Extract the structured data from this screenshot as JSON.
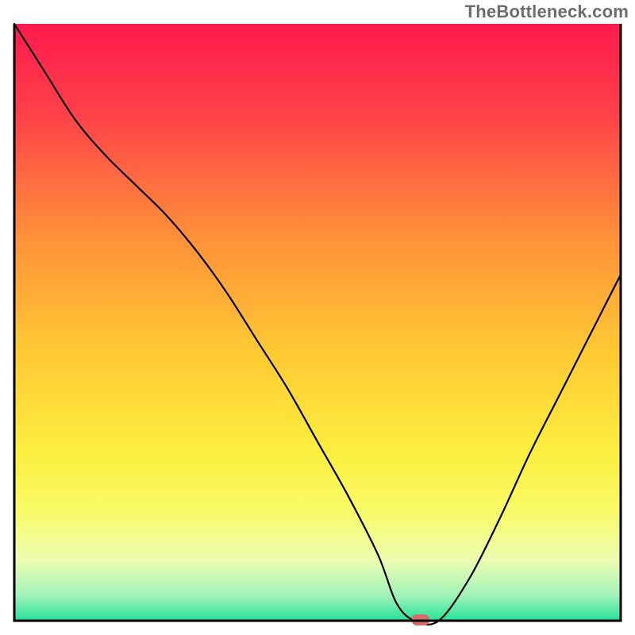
{
  "watermark": "TheBottleneck.com",
  "chart_data": {
    "type": "line",
    "title": "",
    "xlabel": "",
    "ylabel": "",
    "xlim": [
      0,
      100
    ],
    "ylim": [
      0,
      100
    ],
    "series": [
      {
        "name": "bottleneck-curve",
        "x": [
          0,
          5,
          10,
          15,
          20,
          25,
          30,
          35,
          40,
          45,
          50,
          55,
          60,
          63,
          66,
          70,
          75,
          80,
          85,
          90,
          95,
          100
        ],
        "y": [
          100,
          92,
          84,
          78,
          73,
          68,
          62,
          55,
          47,
          39,
          30,
          21,
          11,
          3,
          0,
          0,
          7,
          17,
          28,
          38,
          48,
          58
        ]
      }
    ],
    "marker": {
      "name": "optimal-point",
      "x": 67,
      "y": 0,
      "color": "#d86b6b"
    },
    "background_gradient": {
      "stops": [
        {
          "offset": 0.0,
          "color": "#ff1a4d"
        },
        {
          "offset": 0.15,
          "color": "#ff4049"
        },
        {
          "offset": 0.35,
          "color": "#ff8e3a"
        },
        {
          "offset": 0.55,
          "color": "#ffc933"
        },
        {
          "offset": 0.72,
          "color": "#fcef3f"
        },
        {
          "offset": 0.82,
          "color": "#f8fb6a"
        },
        {
          "offset": 0.9,
          "color": "#ecfdb2"
        },
        {
          "offset": 0.96,
          "color": "#9df2b8"
        },
        {
          "offset": 1.0,
          "color": "#24e29a"
        }
      ]
    },
    "frame_color": "#000000"
  }
}
